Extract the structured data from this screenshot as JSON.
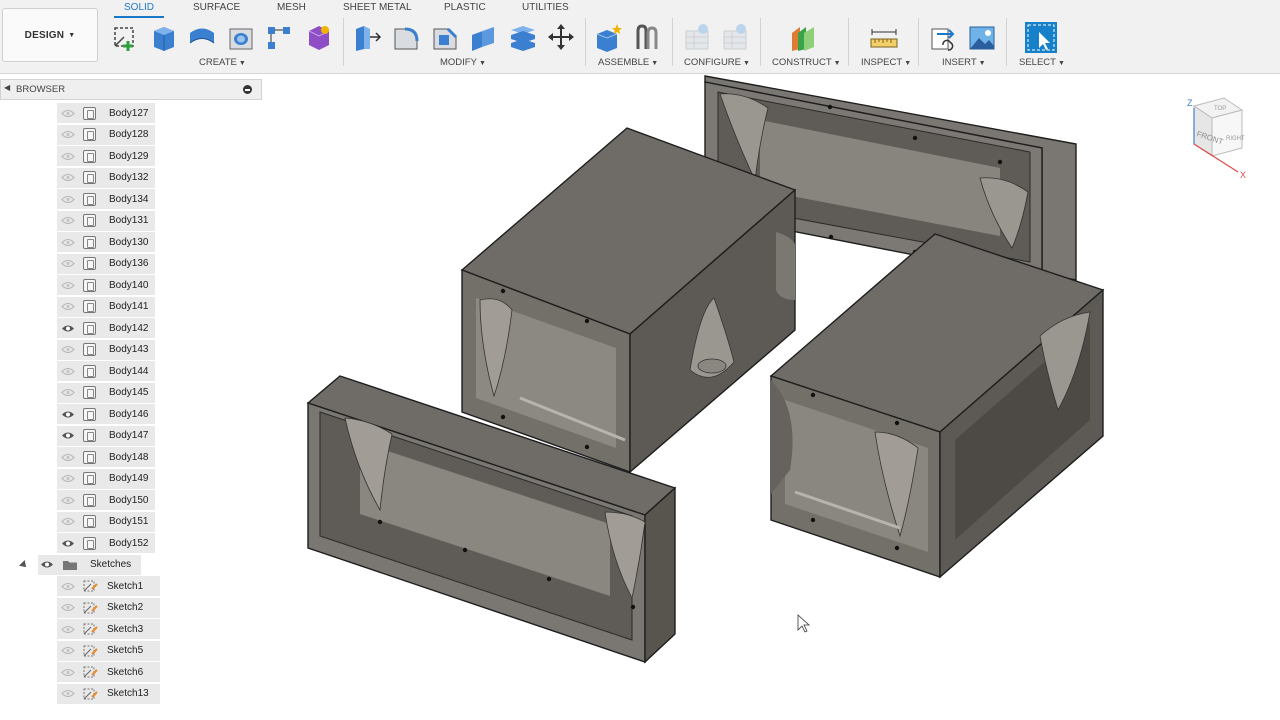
{
  "toolbar": {
    "design_label": "DESIGN",
    "tabs": [
      "SOLID",
      "SURFACE",
      "MESH",
      "SHEET METAL",
      "PLASTIC",
      "UTILITIES"
    ],
    "active_tab": "SOLID",
    "groups": {
      "create": "CREATE",
      "modify": "MODIFY",
      "assemble": "ASSEMBLE",
      "configure": "CONFIGURE",
      "construct": "CONSTRUCT",
      "inspect": "INSPECT",
      "insert": "INSERT",
      "select": "SELECT"
    },
    "accent_color": "#1b78c8"
  },
  "browser": {
    "title": "BROWSER",
    "bodies": [
      {
        "label": "Body127",
        "visible": false
      },
      {
        "label": "Body128",
        "visible": false
      },
      {
        "label": "Body129",
        "visible": false
      },
      {
        "label": "Body132",
        "visible": false
      },
      {
        "label": "Body134",
        "visible": false
      },
      {
        "label": "Body131",
        "visible": false
      },
      {
        "label": "Body130",
        "visible": false
      },
      {
        "label": "Body136",
        "visible": false
      },
      {
        "label": "Body140",
        "visible": false
      },
      {
        "label": "Body141",
        "visible": false
      },
      {
        "label": "Body142",
        "visible": true
      },
      {
        "label": "Body143",
        "visible": false
      },
      {
        "label": "Body144",
        "visible": false
      },
      {
        "label": "Body145",
        "visible": false
      },
      {
        "label": "Body146",
        "visible": true
      },
      {
        "label": "Body147",
        "visible": true
      },
      {
        "label": "Body148",
        "visible": false
      },
      {
        "label": "Body149",
        "visible": false
      },
      {
        "label": "Body150",
        "visible": false
      },
      {
        "label": "Body151",
        "visible": false
      },
      {
        "label": "Body152",
        "visible": true
      }
    ],
    "sketches_folder": "Sketches",
    "sketches": [
      "Sketch1",
      "Sketch2",
      "Sketch3",
      "Sketch5",
      "Sketch6",
      "Sketch13"
    ]
  },
  "viewcube": {
    "top": "TOP",
    "front": "FRONT",
    "right": "RIGHT",
    "axis_z": "Z",
    "axis_x": "X"
  },
  "model": {
    "face_color": "#6f6c67",
    "edge_color": "#1e1e1e"
  }
}
